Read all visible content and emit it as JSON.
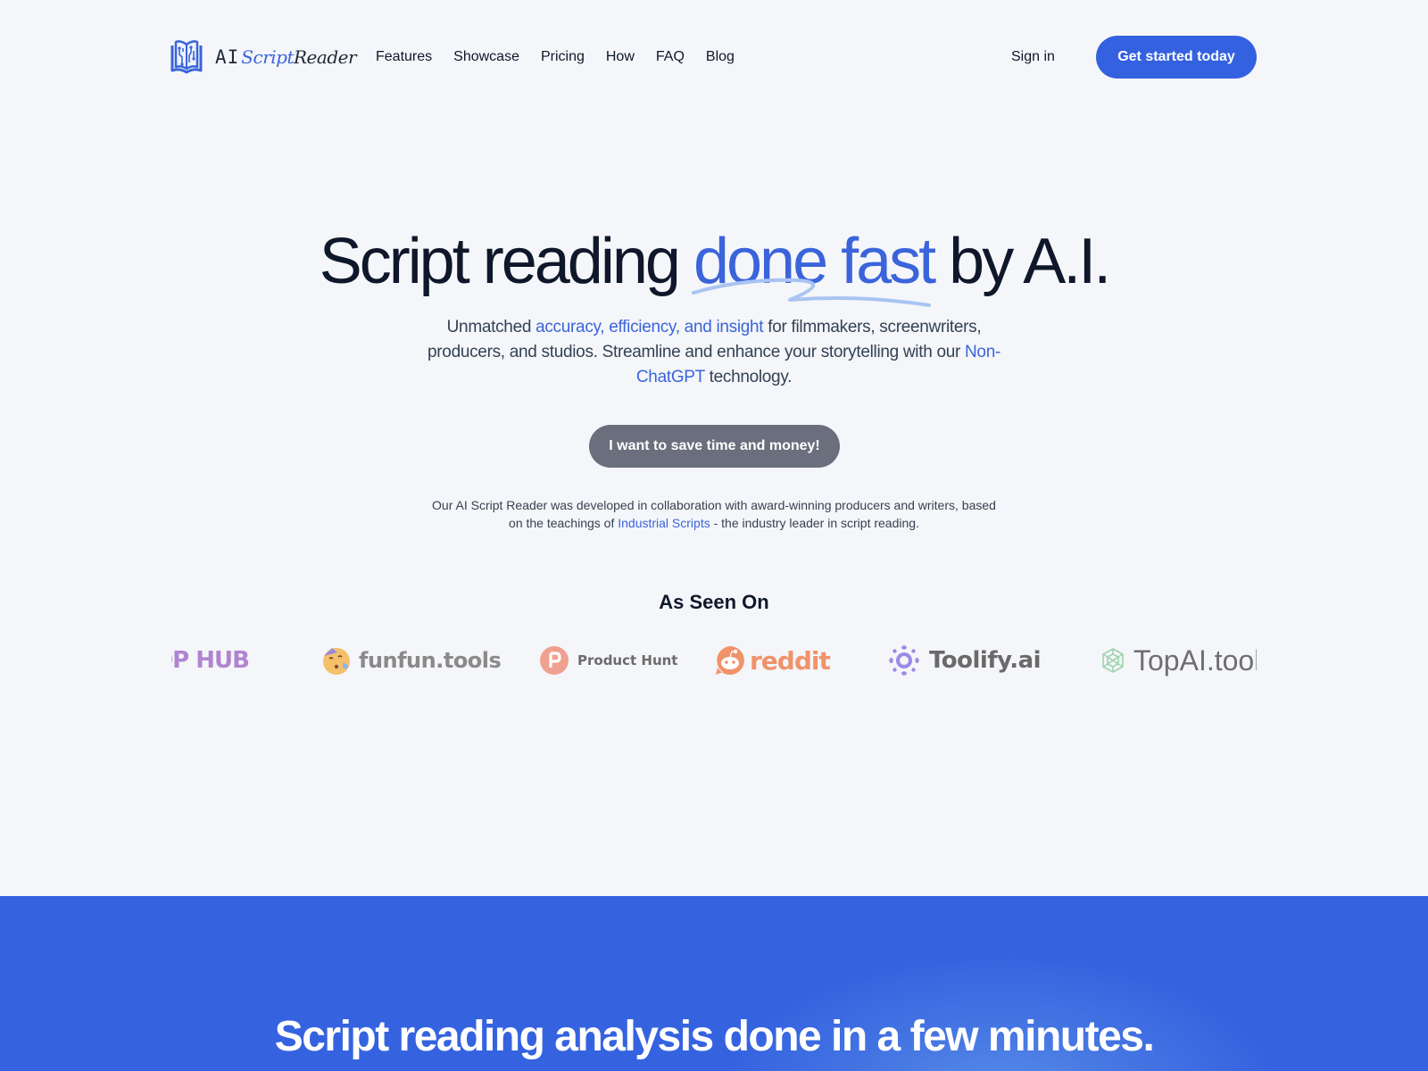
{
  "brand": {
    "name_ai": "AI",
    "name_script": "Script",
    "name_reader": "Reader",
    "icon": "book-circuit-icon",
    "accent_color": "#3461e0"
  },
  "nav": {
    "items": [
      {
        "label": "Features"
      },
      {
        "label": "Showcase"
      },
      {
        "label": "Pricing"
      },
      {
        "label": "How"
      },
      {
        "label": "FAQ"
      },
      {
        "label": "Blog"
      }
    ],
    "sign_in": "Sign in",
    "cta": "Get started today"
  },
  "hero": {
    "title_before": "Script reading ",
    "title_highlight": "done fast",
    "title_after": " by A.I.",
    "sub_1": "Unmatched ",
    "sub_link_1": "accuracy, efficiency, and insight",
    "sub_2": " for filmmakers, screenwriters, producers, and studios. Streamline and enhance your storytelling with our ",
    "sub_link_2": "Non-ChatGPT",
    "sub_3": " technology.",
    "button": "I want to save time and money!",
    "collab_1": "Our AI Script Reader was developed in collaboration with award-winning producers and writers, based on the teachings of ",
    "collab_link": "Industrial Scripts",
    "collab_2": " - the industry leader in script reading."
  },
  "as_seen_on": {
    "title": "As Seen On",
    "logos": [
      {
        "label": "OP HUB",
        "icon": "hub-logo"
      },
      {
        "label": "funfun.tools",
        "icon": "funfun-emoji-icon"
      },
      {
        "label": "Product Hunt",
        "icon": "product-hunt-icon"
      },
      {
        "label": "reddit",
        "icon": "reddit-icon"
      },
      {
        "label": "Toolify.ai",
        "icon": "toolify-icon"
      },
      {
        "label": "TopAI.tools",
        "icon": "topai-icon"
      }
    ]
  },
  "section2": {
    "title": "Script reading analysis done in a few minutes."
  }
}
